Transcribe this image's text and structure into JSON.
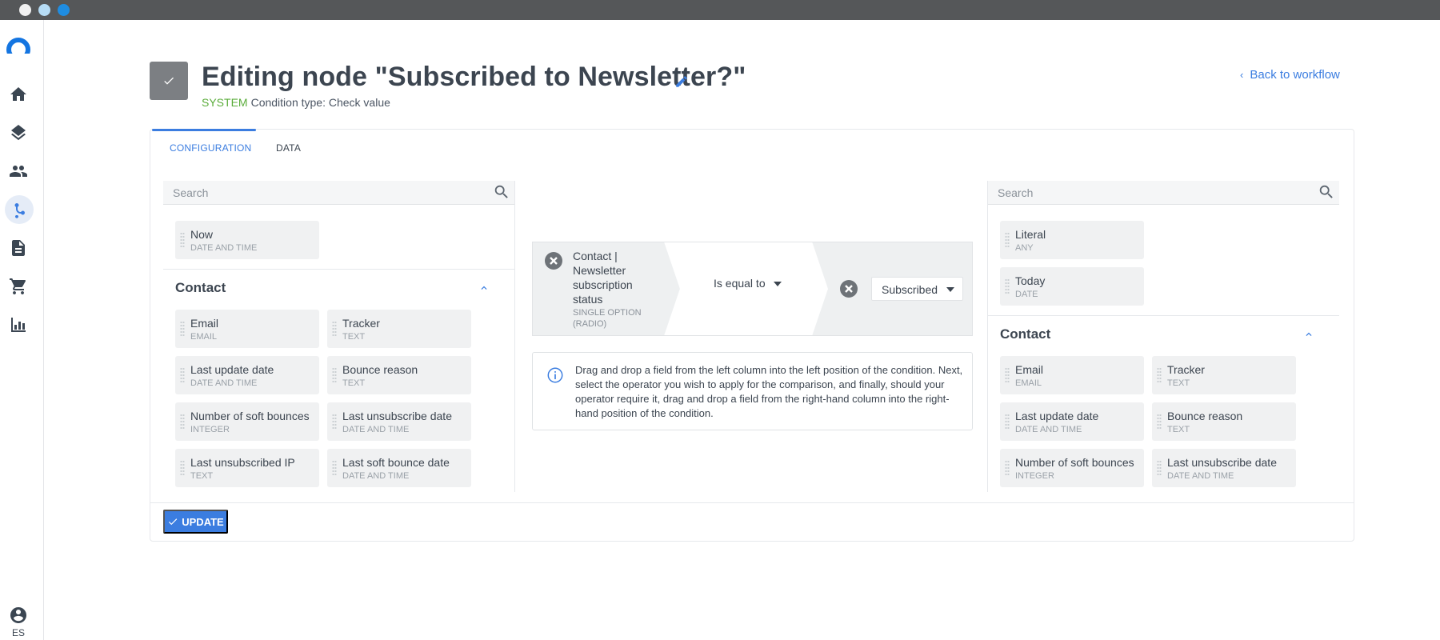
{
  "window": {
    "controls": [
      "close",
      "minimize",
      "maximize"
    ]
  },
  "sidebar": {
    "items": [
      {
        "id": "home",
        "icon": "home-icon"
      },
      {
        "id": "layers",
        "icon": "layers-icon"
      },
      {
        "id": "contacts",
        "icon": "people-icon"
      },
      {
        "id": "workflows",
        "icon": "workflow-icon",
        "active": true
      },
      {
        "id": "documents",
        "icon": "document-icon"
      },
      {
        "id": "ecommerce",
        "icon": "cart-icon"
      },
      {
        "id": "reports",
        "icon": "bar-chart-icon"
      }
    ],
    "user": {
      "icon": "account-icon",
      "language": "ES"
    }
  },
  "header": {
    "title": "Editing node \"Subscribed to Newsletter?\"",
    "system_label": "SYSTEM",
    "condition_type": "Condition type: Check value",
    "back_link": "Back to workflow"
  },
  "tabs": [
    {
      "label": "CONFIGURATION",
      "active": true
    },
    {
      "label": "DATA",
      "active": false
    }
  ],
  "left_column": {
    "search_placeholder": "Search",
    "top_fields": [
      {
        "name": "Now",
        "type": "DATE AND TIME"
      }
    ],
    "group": {
      "title": "Contact",
      "fields": [
        {
          "name": "Email",
          "type": "EMAIL"
        },
        {
          "name": "Tracker",
          "type": "TEXT"
        },
        {
          "name": "Last update date",
          "type": "DATE AND TIME"
        },
        {
          "name": "Bounce reason",
          "type": "TEXT"
        },
        {
          "name": "Number of soft bounces",
          "type": "INTEGER"
        },
        {
          "name": "Last unsubscribe date",
          "type": "DATE AND TIME"
        },
        {
          "name": "Last unsubscribed IP",
          "type": "TEXT"
        },
        {
          "name": "Last soft bounce date",
          "type": "DATE AND TIME"
        }
      ]
    }
  },
  "right_column": {
    "search_placeholder": "Search",
    "top_fields": [
      {
        "name": "Literal",
        "type": "ANY"
      },
      {
        "name": "Today",
        "type": "DATE"
      }
    ],
    "group": {
      "title": "Contact",
      "fields": [
        {
          "name": "Email",
          "type": "EMAIL"
        },
        {
          "name": "Tracker",
          "type": "TEXT"
        },
        {
          "name": "Last update date",
          "type": "DATE AND TIME"
        },
        {
          "name": "Bounce reason",
          "type": "TEXT"
        },
        {
          "name": "Number of soft bounces",
          "type": "INTEGER"
        },
        {
          "name": "Last unsubscribe date",
          "type": "DATE AND TIME"
        }
      ]
    }
  },
  "condition": {
    "left_field": {
      "name": "Contact | Newsletter subscription status",
      "type": "SINGLE OPTION (RADIO)"
    },
    "operator": "Is equal to",
    "right_value": "Subscribed"
  },
  "info": {
    "text": "Drag and drop a field from the left column into the left position of the condition. Next, select the operator you wish to apply for the comparison, and finally, should your operator require it, drag and drop a field from the right-hand column into the right-hand position of the condition."
  },
  "footer": {
    "update_label": "UPDATE"
  },
  "colors": {
    "accent": "#3b7de0",
    "system_green": "#5aac3a",
    "titlebar": "#555759"
  }
}
